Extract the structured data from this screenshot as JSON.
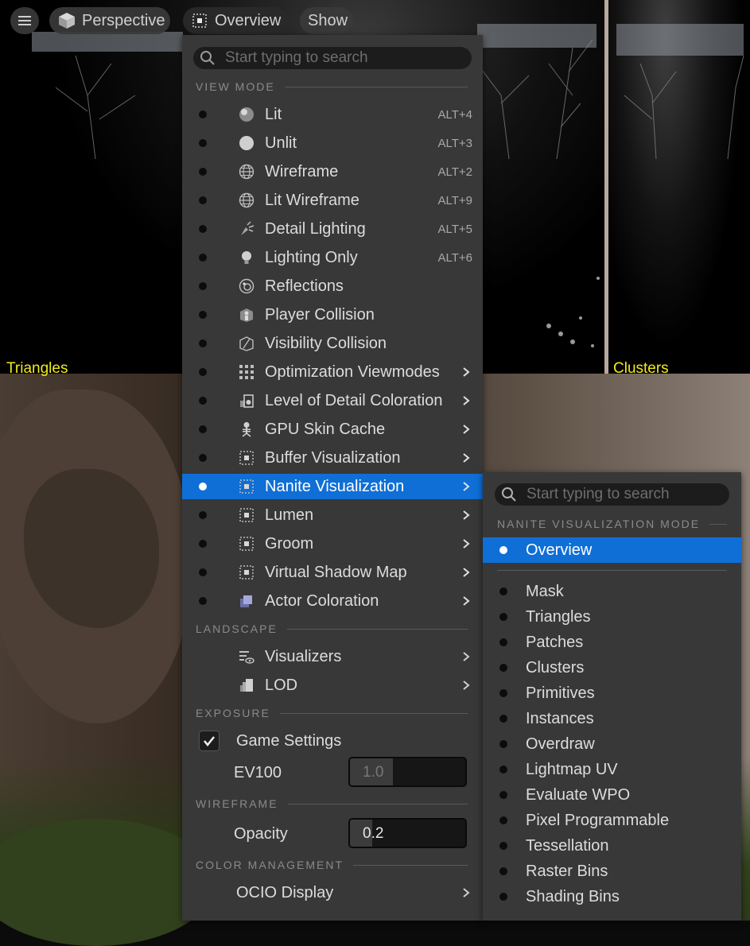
{
  "toolbar": {
    "perspective_label": "Perspective",
    "overview_label": "Overview",
    "show_label": "Show"
  },
  "viewports": {
    "left_label": "Triangles",
    "right_label": "Clusters"
  },
  "menu": {
    "search_placeholder": "Start typing to search",
    "sections": {
      "view_mode": "VIEW MODE",
      "landscape": "LANDSCAPE",
      "exposure": "EXPOSURE",
      "wireframe": "WIREFRAME",
      "color_management": "COLOR MANAGEMENT"
    },
    "view_modes": [
      {
        "label": "Lit",
        "shortcut": "ALT+4",
        "icon": "lit-sphere-icon"
      },
      {
        "label": "Unlit",
        "shortcut": "ALT+3",
        "icon": "unlit-sphere-icon"
      },
      {
        "label": "Wireframe",
        "shortcut": "ALT+2",
        "icon": "wireframe-globe-icon"
      },
      {
        "label": "Lit Wireframe",
        "shortcut": "ALT+9",
        "icon": "wireframe-globe-icon"
      },
      {
        "label": "Detail Lighting",
        "shortcut": "ALT+5",
        "icon": "detail-lighting-icon"
      },
      {
        "label": "Lighting Only",
        "shortcut": "ALT+6",
        "icon": "lightbulb-icon"
      },
      {
        "label": "Reflections",
        "shortcut": "",
        "icon": "reflection-icon"
      },
      {
        "label": "Player Collision",
        "shortcut": "",
        "icon": "player-collision-icon"
      },
      {
        "label": "Visibility Collision",
        "shortcut": "",
        "icon": "visibility-collision-icon"
      },
      {
        "label": "Optimization Viewmodes",
        "shortcut": "",
        "icon": "grid-icon",
        "submenu": true
      },
      {
        "label": "Level of Detail Coloration",
        "shortcut": "",
        "icon": "lod-coloration-icon",
        "submenu": true
      },
      {
        "label": "GPU Skin Cache",
        "shortcut": "",
        "icon": "skeleton-icon",
        "submenu": true
      },
      {
        "label": "Buffer Visualization",
        "shortcut": "",
        "icon": "dotted-square-icon",
        "submenu": true
      },
      {
        "label": "Nanite Visualization",
        "shortcut": "",
        "icon": "dotted-square-icon",
        "submenu": true,
        "highlighted": true
      },
      {
        "label": "Lumen",
        "shortcut": "",
        "icon": "dotted-square-icon",
        "submenu": true
      },
      {
        "label": "Groom",
        "shortcut": "",
        "icon": "dotted-square-icon",
        "submenu": true
      },
      {
        "label": "Virtual Shadow Map",
        "shortcut": "",
        "icon": "dotted-square-icon",
        "submenu": true
      },
      {
        "label": "Actor Coloration",
        "shortcut": "",
        "icon": "actor-coloration-icon",
        "submenu": true
      }
    ],
    "landscape": [
      {
        "label": "Visualizers",
        "icon": "visualizers-icon"
      },
      {
        "label": "LOD",
        "icon": "lod-icon"
      }
    ],
    "exposure": {
      "game_settings_label": "Game Settings",
      "game_settings_checked": true,
      "ev100_label": "EV100",
      "ev100_value": "1.0"
    },
    "wireframe": {
      "opacity_label": "Opacity",
      "opacity_value": "0.2"
    },
    "color_management": {
      "ocio_label": "OCIO Display"
    }
  },
  "submenu": {
    "search_placeholder": "Start typing to search",
    "section": "NANITE VISUALIZATION MODE",
    "selected": "Overview",
    "items": [
      "Mask",
      "Triangles",
      "Patches",
      "Clusters",
      "Primitives",
      "Instances",
      "Overdraw",
      "Lightmap UV",
      "Evaluate WPO",
      "Pixel Programmable",
      "Tessellation",
      "Raster Bins",
      "Shading Bins"
    ]
  },
  "colors": {
    "highlight": "#0f6fd6",
    "menu_bg": "#383838",
    "viewport_label": "#f2ea1f"
  }
}
